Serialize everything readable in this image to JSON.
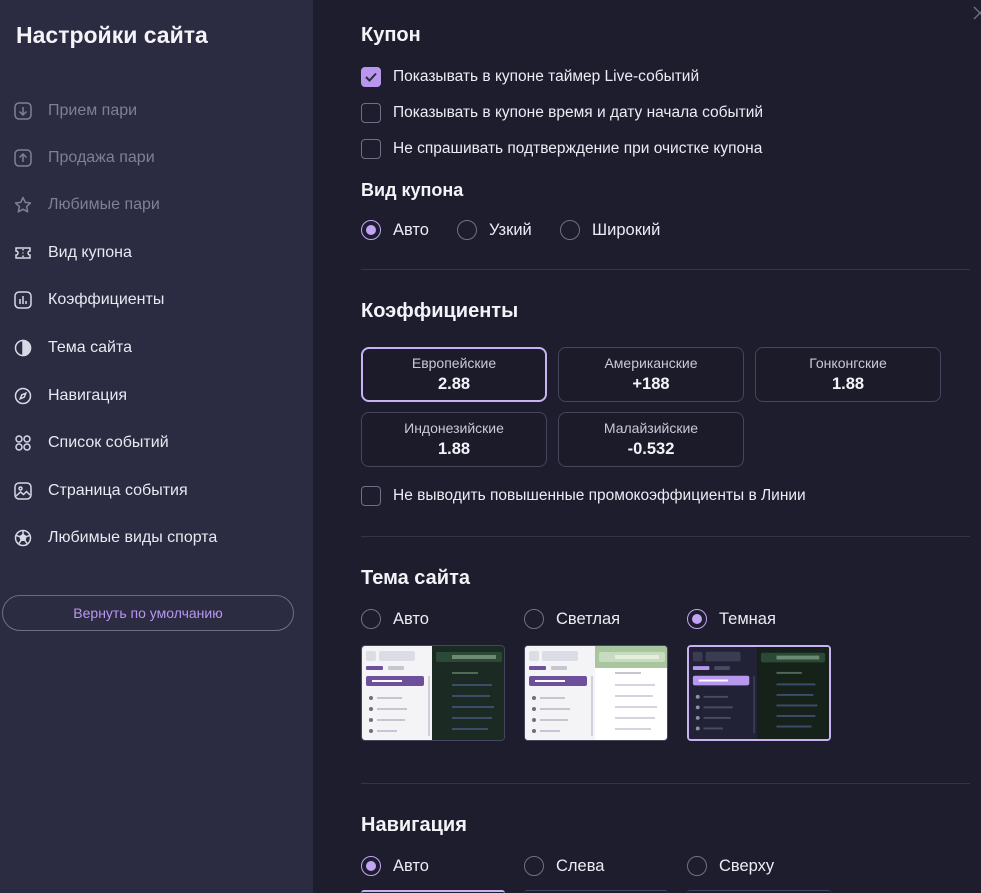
{
  "sidebar": {
    "title": "Настройки сайта",
    "items": [
      {
        "label": "Прием пари",
        "icon": "arrow-down-square-icon",
        "dim": true
      },
      {
        "label": "Продажа пари",
        "icon": "arrow-up-square-icon",
        "dim": true
      },
      {
        "label": "Любимые пари",
        "icon": "star-icon",
        "dim": true
      },
      {
        "label": "Вид купона",
        "icon": "ticket-icon",
        "dim": false
      },
      {
        "label": "Коэффициенты",
        "icon": "bar-chart-icon",
        "dim": false
      },
      {
        "label": "Тема сайта",
        "icon": "half-circle-icon",
        "dim": false
      },
      {
        "label": "Навигация",
        "icon": "compass-icon",
        "dim": false
      },
      {
        "label": "Список событий",
        "icon": "grid-circles-icon",
        "dim": false
      },
      {
        "label": "Страница события",
        "icon": "image-icon",
        "dim": false
      },
      {
        "label": "Любимые виды спорта",
        "icon": "soccer-ball-icon",
        "dim": false
      }
    ],
    "reset_label": "Вернуть по умолчанию"
  },
  "coupon": {
    "title": "Купон",
    "checks": [
      {
        "label": "Показывать в купоне таймер Live-событий",
        "checked": true
      },
      {
        "label": "Показывать в купоне время и дату начала событий",
        "checked": false
      },
      {
        "label": "Не спрашивать подтверждение при очистке купона",
        "checked": false
      }
    ],
    "view_title": "Вид купона",
    "view_options": [
      {
        "label": "Авто",
        "selected": true
      },
      {
        "label": "Узкий",
        "selected": false
      },
      {
        "label": "Широкий",
        "selected": false
      }
    ]
  },
  "odds": {
    "title": "Коэффициенты",
    "formats": [
      {
        "name": "Европейские",
        "value": "2.88",
        "selected": true
      },
      {
        "name": "Американские",
        "value": "+188",
        "selected": false
      },
      {
        "name": "Гонконгские",
        "value": "1.88",
        "selected": false
      },
      {
        "name": "Индонезийские",
        "value": "1.88",
        "selected": false
      },
      {
        "name": "Малайзийские",
        "value": "-0.532",
        "selected": false
      }
    ],
    "promo_check": {
      "label": "Не выводить повышенные промокоэффициенты в Линии",
      "checked": false
    }
  },
  "theme": {
    "title": "Тема сайта",
    "options": [
      {
        "label": "Авто",
        "selected": false
      },
      {
        "label": "Светлая",
        "selected": false
      },
      {
        "label": "Темная",
        "selected": true
      }
    ]
  },
  "navigation": {
    "title": "Навигация",
    "options": [
      {
        "label": "Авто",
        "selected": true
      },
      {
        "label": "Слева",
        "selected": false
      },
      {
        "label": "Сверху",
        "selected": false
      }
    ]
  },
  "colors": {
    "accent": "#b897ee",
    "sidebar_bg": "#2b2b41",
    "main_bg": "#1d1d2e"
  }
}
